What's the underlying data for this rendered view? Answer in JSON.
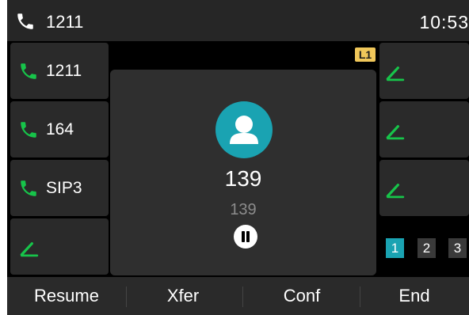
{
  "status_bar": {
    "number": "1211",
    "time": "10:53"
  },
  "line_keys_left": [
    {
      "label": "1211",
      "icon": "phone-icon"
    },
    {
      "label": "164",
      "icon": "phone-icon"
    },
    {
      "label": "SIP3",
      "icon": "phone-icon"
    },
    {
      "label": "",
      "icon": "edit-icon"
    }
  ],
  "line_keys_right": [
    {
      "label": "",
      "icon": "edit-icon"
    },
    {
      "label": "",
      "icon": "edit-icon"
    },
    {
      "label": "",
      "icon": "edit-icon"
    }
  ],
  "call": {
    "line_badge": "L1",
    "name": "139",
    "number": "139",
    "state_icon": "pause-icon"
  },
  "pager": {
    "pages": [
      "1",
      "2",
      "3"
    ],
    "active": "1"
  },
  "softkeys": [
    "Resume",
    "Xfer",
    "Conf",
    "End"
  ],
  "colors": {
    "accent": "#1aa3b2",
    "phone_green": "#17c44a",
    "badge": "#f0c75a"
  }
}
